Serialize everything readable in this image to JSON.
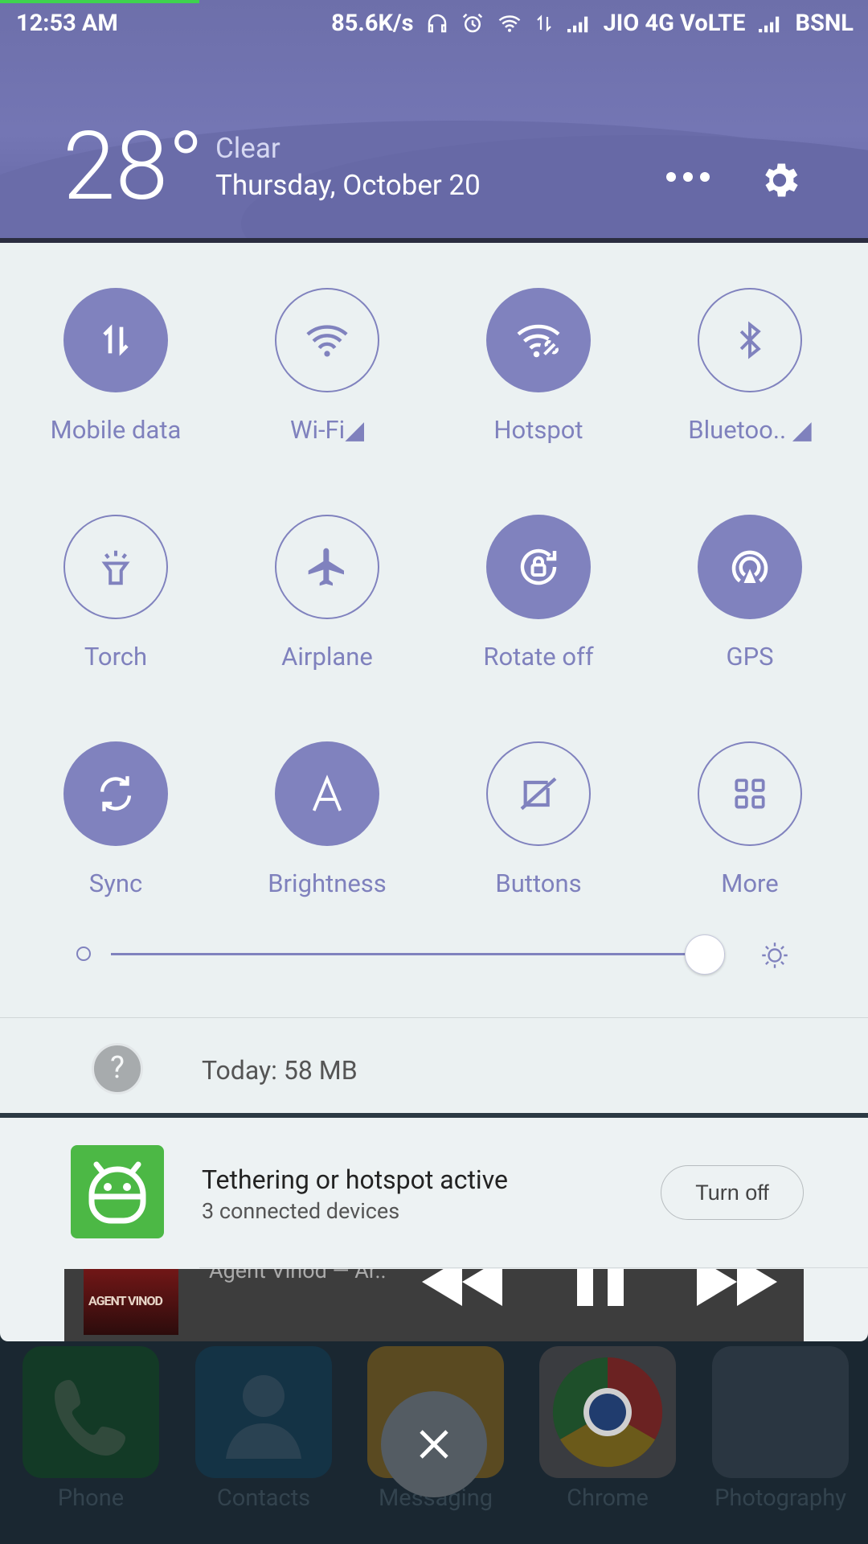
{
  "status_bar": {
    "time": "12:53 AM",
    "speed": "85.6K/s",
    "network1": "JIO 4G VoLTE",
    "network2": "BSNL"
  },
  "header": {
    "temperature": "28°",
    "condition": "Clear",
    "date": "Thursday, October 20"
  },
  "tiles": [
    {
      "label": "Mobile data",
      "icon": "mobile-data-icon",
      "on": true
    },
    {
      "label": "Wi-Fi◢",
      "icon": "wifi-icon",
      "on": false
    },
    {
      "label": "Hotspot",
      "icon": "hotspot-icon",
      "on": true
    },
    {
      "label": "Bluetoo.. ◢",
      "icon": "bluetooth-icon",
      "on": false
    },
    {
      "label": "Torch",
      "icon": "torch-icon",
      "on": false
    },
    {
      "label": "Airplane",
      "icon": "airplane-icon",
      "on": false
    },
    {
      "label": "Rotate off",
      "icon": "rotate-lock-icon",
      "on": true
    },
    {
      "label": "GPS",
      "icon": "gps-icon",
      "on": true
    },
    {
      "label": "Sync",
      "icon": "sync-icon",
      "on": true
    },
    {
      "label": "Brightness",
      "icon": "brightness-auto-icon",
      "on": true
    },
    {
      "label": "Buttons",
      "icon": "buttons-icon",
      "on": false
    },
    {
      "label": "More",
      "icon": "more-grid-icon",
      "on": false
    }
  ],
  "brightness": {
    "level": 1.0
  },
  "data_usage": {
    "help": "?",
    "text": "Today: 58 MB"
  },
  "notification": {
    "title": "Tethering or hotspot active",
    "subtitle": "3 connected devices",
    "action": "Turn off"
  },
  "media": {
    "title": "Agent Vinod — Ar..",
    "art_text": "AGENT VINOD"
  },
  "dock": [
    {
      "label": "Phone",
      "icon": "phone-icon"
    },
    {
      "label": "Contacts",
      "icon": "contacts-icon"
    },
    {
      "label": "Messaging",
      "icon": "messaging-icon"
    },
    {
      "label": "Chrome",
      "icon": "chrome-icon"
    },
    {
      "label": "Photography",
      "icon": "folder-icon"
    }
  ],
  "colors": {
    "accent": "#8082be",
    "header": "#7476b4",
    "panel": "#ebf1f2",
    "hotspot_icon_bg": "#4cb845"
  }
}
